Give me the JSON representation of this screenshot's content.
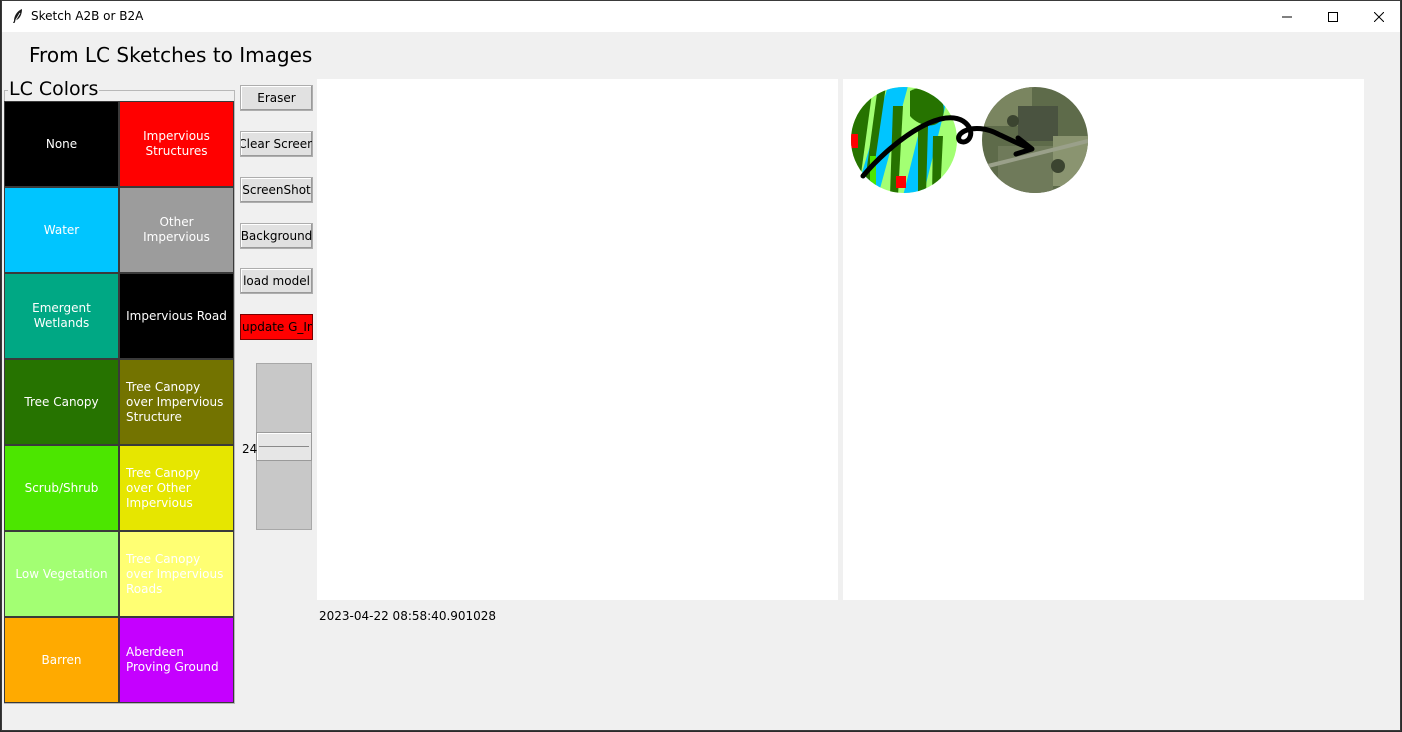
{
  "window": {
    "title": "Sketch A2B or B2A",
    "app_icon": "feather-icon",
    "controls": [
      "minimize-icon",
      "maximize-icon",
      "close-icon"
    ]
  },
  "heading": "From LC Sketches to Images",
  "lc_colors": {
    "legend": "LC Colors",
    "items": [
      {
        "label": "None",
        "bg": "#000000",
        "fg": "#ffffff"
      },
      {
        "label": "Impervious Structures",
        "bg": "#ff0000",
        "fg": "#ffffff"
      },
      {
        "label": "Water",
        "bg": "#00c5ff",
        "fg": "#ffffff"
      },
      {
        "label": "Other Impervious",
        "bg": "#9c9c9c",
        "fg": "#ffffff"
      },
      {
        "label": "Emergent Wetlands",
        "bg": "#00a884",
        "fg": "#ffffff"
      },
      {
        "label": "Impervious Road",
        "bg": "#000000",
        "fg": "#ffffff"
      },
      {
        "label": "Tree Canopy",
        "bg": "#267300",
        "fg": "#ffffff"
      },
      {
        "label": "Tree Canopy over Impervious Structure",
        "bg": "#737300",
        "fg": "#ffffff"
      },
      {
        "label": "Scrub/Shrub",
        "bg": "#4ce600",
        "fg": "#ffffff"
      },
      {
        "label": "Tree Canopy over Other Impervious",
        "bg": "#e6e600",
        "fg": "#ffffff"
      },
      {
        "label": "Low Vegetation",
        "bg": "#a3ff73",
        "fg": "#ffffff"
      },
      {
        "label": "Tree Canopy over Impervious Roads",
        "bg": "#ffff73",
        "fg": "#ffffff"
      },
      {
        "label": "Barren",
        "bg": "#ffaa00",
        "fg": "#ffffff"
      },
      {
        "label": "Aberdeen Proving Ground",
        "bg": "#c500ff",
        "fg": "#ffffff"
      }
    ]
  },
  "buttons": {
    "eraser": "Eraser",
    "clear": "Clear Screen",
    "screenshot": "ScreenShot",
    "background": "Background",
    "load_model": "load model",
    "update": "update G_Img"
  },
  "brush_size": "24",
  "timestamp": "2023-04-22 08:58:40.901028",
  "colors": {
    "window_bg": "#f0f0f0",
    "canvas_bg": "#ffffff",
    "update_button": "#ff0000"
  }
}
